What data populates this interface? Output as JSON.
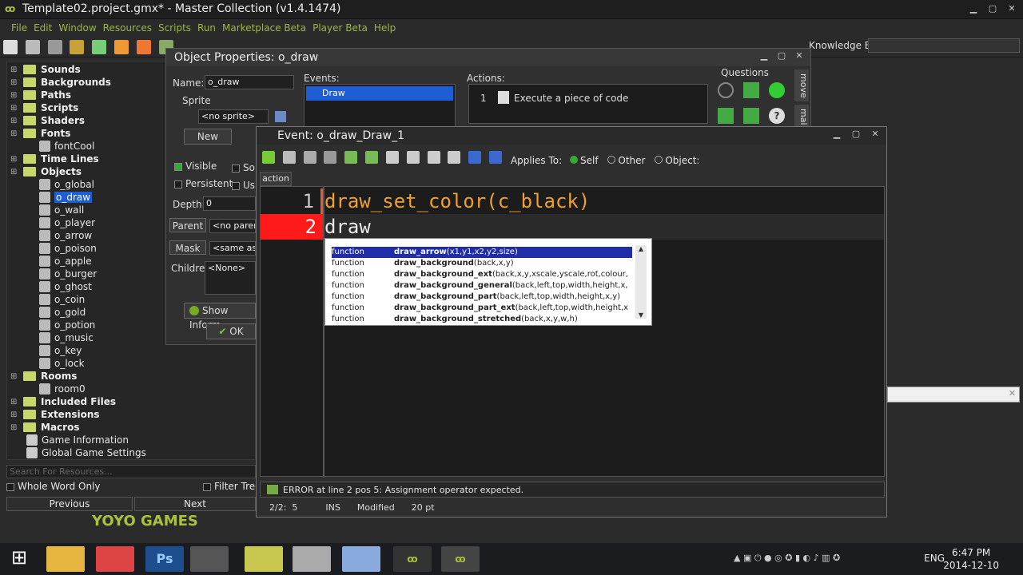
{
  "window": {
    "title": "Template02.project.gmx*  -  Master Collection (v1.4.1474)"
  },
  "menu": [
    "File",
    "Edit",
    "Window",
    "Resources",
    "Scripts",
    "Run",
    "Marketplace Beta",
    "Player Beta",
    "Help"
  ],
  "knowledge_base": {
    "label": "Knowledge Base:",
    "value": ""
  },
  "tree": {
    "items": [
      {
        "label": "Sounds",
        "type": "folder",
        "bold": true
      },
      {
        "label": "Backgrounds",
        "type": "folder",
        "bold": true
      },
      {
        "label": "Paths",
        "type": "folder",
        "bold": true
      },
      {
        "label": "Scripts",
        "type": "folder",
        "bold": true
      },
      {
        "label": "Shaders",
        "type": "folder",
        "bold": true
      },
      {
        "label": "Fonts",
        "type": "folder",
        "bold": true
      },
      {
        "label": "fontCool",
        "type": "child"
      },
      {
        "label": "Time Lines",
        "type": "folder",
        "bold": true
      },
      {
        "label": "Objects",
        "type": "folder",
        "bold": true
      },
      {
        "label": "o_global",
        "type": "child"
      },
      {
        "label": "o_draw",
        "type": "child",
        "selected": true
      },
      {
        "label": "o_wall",
        "type": "child"
      },
      {
        "label": "o_player",
        "type": "child"
      },
      {
        "label": "o_arrow",
        "type": "child"
      },
      {
        "label": "o_poison",
        "type": "child"
      },
      {
        "label": "o_apple",
        "type": "child"
      },
      {
        "label": "o_burger",
        "type": "child"
      },
      {
        "label": "o_ghost",
        "type": "child"
      },
      {
        "label": "o_coin",
        "type": "child"
      },
      {
        "label": "o_gold",
        "type": "child"
      },
      {
        "label": "o_potion",
        "type": "child"
      },
      {
        "label": "o_music",
        "type": "child"
      },
      {
        "label": "o_key",
        "type": "child"
      },
      {
        "label": "o_lock",
        "type": "child"
      },
      {
        "label": "Rooms",
        "type": "folder",
        "bold": true
      },
      {
        "label": "room0",
        "type": "child"
      },
      {
        "label": "Included Files",
        "type": "folder",
        "bold": true
      },
      {
        "label": "Extensions",
        "type": "folder",
        "bold": true
      },
      {
        "label": "Macros",
        "type": "folder",
        "bold": true
      },
      {
        "label": "Game Information",
        "type": "leaf"
      },
      {
        "label": "Global Game Settings",
        "type": "leaf"
      }
    ],
    "search_placeholder": "Search For Resources...",
    "whole_word_only": "Whole Word Only",
    "filter_tree": "Filter Tree",
    "previous": "Previous",
    "next": "Next"
  },
  "brand": "YOYO GAMES",
  "object_properties": {
    "title": "Object Properties: o_draw",
    "name_label": "Name:",
    "name_value": "o_draw",
    "sprite_label": "Sprite",
    "sprite_value": "<no sprite>",
    "new_button": "New",
    "visible": "Visible",
    "solid": "So",
    "persistent": "Persistent",
    "uses": "Us",
    "depth_label": "Depth:",
    "depth_value": "0",
    "parent_button": "Parent",
    "parent_value": "<no parent>",
    "mask_button": "Mask",
    "mask_value": "<same as sp",
    "children_label": "Children:",
    "children_value": "<None>",
    "show_info": "Show Inform",
    "ok": "OK",
    "events_label": "Events:",
    "event_selected": "Draw",
    "actions_label": "Actions:",
    "action_num": "1",
    "action_text": "Execute a piece of code",
    "questions_label": "Questions",
    "side_tabs": [
      "move",
      "mai"
    ]
  },
  "editor": {
    "title": "Event: o_draw_Draw_1",
    "applies_to": "Applies To:",
    "self": "Self",
    "other": "Other",
    "object": "Object:",
    "tab": "action",
    "lines": [
      {
        "num": "1",
        "text": "draw_set_color(c_black)"
      },
      {
        "num": "2",
        "text": "draw"
      }
    ],
    "autocomplete": [
      {
        "kind": "function",
        "name": "draw_arrow",
        "args": "(x1,y1,x2,y2,size)"
      },
      {
        "kind": "function",
        "name": "draw_background",
        "args": "(back,x,y)"
      },
      {
        "kind": "function",
        "name": "draw_background_ext",
        "args": "(back,x,y,xscale,yscale,rot,colour,"
      },
      {
        "kind": "function",
        "name": "draw_background_general",
        "args": "(back,left,top,width,height,x,"
      },
      {
        "kind": "function",
        "name": "draw_background_part",
        "args": "(back,left,top,width,height,x,y)"
      },
      {
        "kind": "function",
        "name": "draw_background_part_ext",
        "args": "(back,left,top,width,height,x"
      },
      {
        "kind": "function",
        "name": "draw_background_stretched",
        "args": "(back,x,y,w,h)"
      }
    ],
    "error": "ERROR at line 2 pos 5: Assignment operator expected.",
    "status": {
      "pos": "2/2:",
      "col": "5",
      "ins": "INS",
      "modified": "Modified",
      "size": "20 pt"
    }
  },
  "taskbar": {
    "lang": "ENG",
    "time": "6:47 PM",
    "date": "2014-12-10"
  }
}
